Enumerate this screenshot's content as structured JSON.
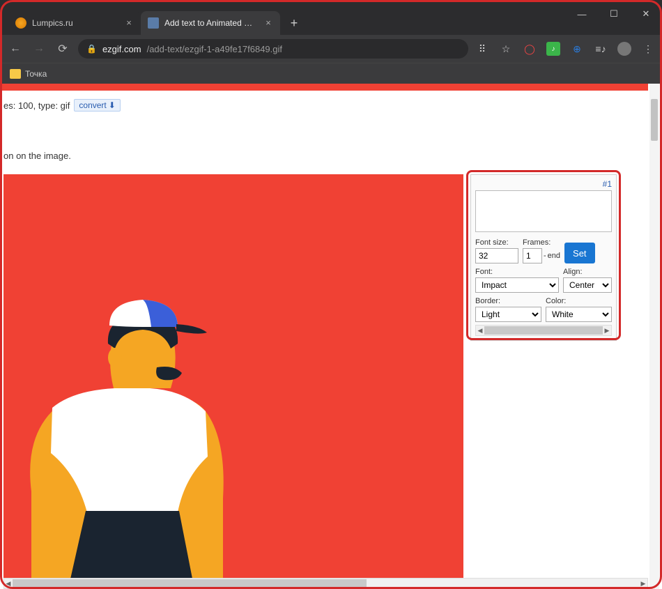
{
  "window": {
    "minimize": "—",
    "maximize": "☐",
    "close": "✕"
  },
  "tabs": [
    {
      "title": "Lumpics.ru",
      "active": false
    },
    {
      "title": "Add text to Animated GIFs - gif-...",
      "active": true
    }
  ],
  "newtab": "+",
  "url": {
    "domain": "ezgif.com",
    "path": "/add-text/ezgif-1-a49fe17f6849.gif"
  },
  "bookmarks": {
    "item1": "Точка"
  },
  "page": {
    "info_frames": "es: 100, type: gif",
    "convert_label": "convert",
    "info2": "on on the image."
  },
  "panel": {
    "id": "#1",
    "text_value": "",
    "font_size_label": "Font size:",
    "font_size_value": "32",
    "frames_label": "Frames:",
    "frames_from": "1",
    "frames_sep": "-",
    "frames_to": "end",
    "set_label": "Set",
    "font_label": "Font:",
    "font_value": "Impact",
    "align_label": "Align:",
    "align_value": "Center",
    "border_label": "Border:",
    "border_value": "Light",
    "color_label": "Color:",
    "color_value": "White"
  }
}
